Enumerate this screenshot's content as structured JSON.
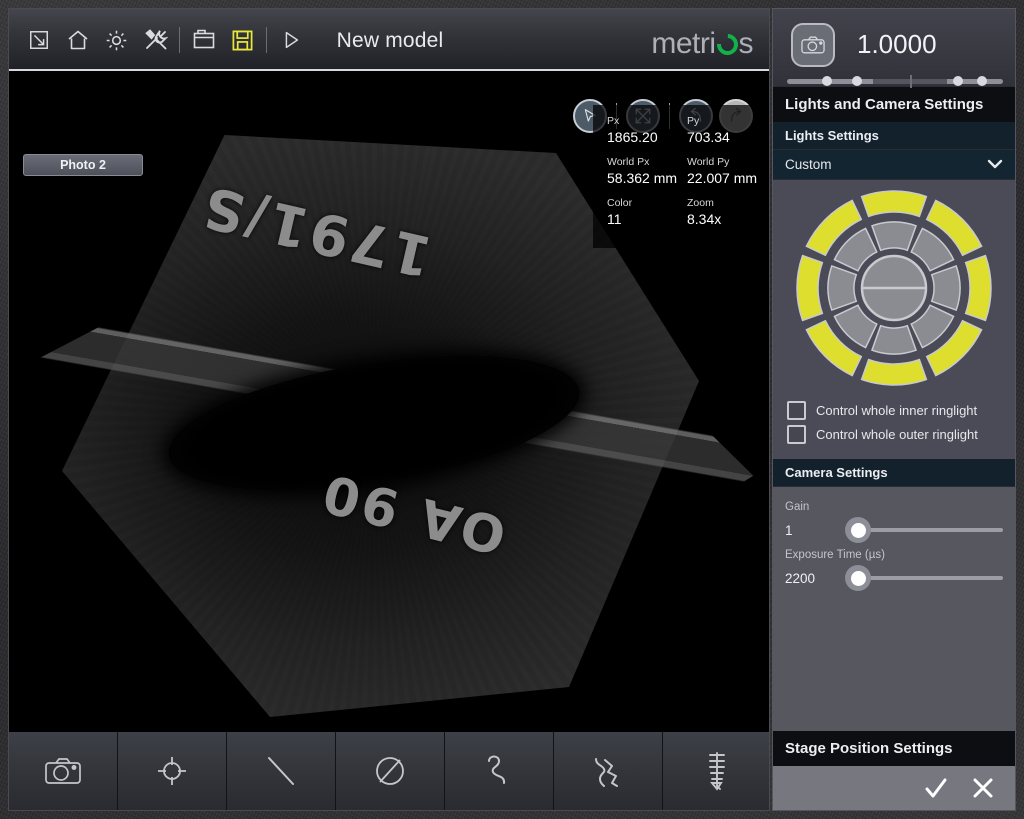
{
  "window": {
    "title": "New model",
    "brand": "metri",
    "brand_tail": "s"
  },
  "toolbar": {
    "items": [
      {
        "name": "resize-icon",
        "label": "Resize"
      },
      {
        "name": "home-icon",
        "label": "Home"
      },
      {
        "name": "gear-icon",
        "label": "Settings"
      },
      {
        "name": "tools-icon",
        "label": "Tools"
      },
      {
        "name": "folder-icon",
        "label": "Open"
      },
      {
        "name": "save-icon",
        "label": "Save"
      },
      {
        "name": "play-icon",
        "label": "Run"
      }
    ]
  },
  "canvas": {
    "photo_tab": "Photo 2",
    "marking_top": "1791/S",
    "marking_bottom": "OA 90",
    "nav_buttons": [
      {
        "name": "pointer-icon",
        "label": "Select"
      },
      {
        "name": "fit-screen-icon",
        "label": "Fit to screen"
      },
      {
        "name": "undo-icon",
        "label": "Undo"
      },
      {
        "name": "redo-icon",
        "label": "Redo"
      }
    ]
  },
  "info": {
    "px_label": "Px",
    "px_value": "1865.20",
    "py_label": "Py",
    "py_value": "703.34",
    "world_px_label": "World Px",
    "world_px_value": "58.362 mm",
    "world_py_label": "World Py",
    "world_py_value": "22.007 mm",
    "color_label": "Color",
    "color_value": "11",
    "zoom_label": "Zoom",
    "zoom_value": "8.34x"
  },
  "measure_tools": [
    {
      "name": "camera-icon",
      "label": "Capture photo"
    },
    {
      "name": "point-icon",
      "label": "Point"
    },
    {
      "name": "line-icon",
      "label": "Line"
    },
    {
      "name": "circle-icon",
      "label": "Circle"
    },
    {
      "name": "curve-icon",
      "label": "Curve"
    },
    {
      "name": "profile-icon",
      "label": "Profile"
    },
    {
      "name": "thread-icon",
      "label": "Thread"
    }
  ],
  "right_panel": {
    "zoom_factor": "1.0000",
    "camera_badge_icon": "camera-icon",
    "section_title": "Lights and Camera Settings",
    "lights": {
      "sub_title": "Lights Settings",
      "preset_selected": "Custom",
      "preset_options": [
        "Custom"
      ],
      "outer_ring_color": "#ddde2e",
      "inner_ring_color": "#8a8c92",
      "checkboxes": [
        {
          "label": "Control whole inner ringlight",
          "checked": false
        },
        {
          "label": "Control whole outer ringlight",
          "checked": false
        }
      ]
    },
    "camera": {
      "sub_title": "Camera Settings",
      "gain_label": "Gain",
      "gain_value": "1",
      "exposure_label": "Exposure Time (µs)",
      "exposure_value": "2200"
    },
    "stage_title": "Stage Position Settings",
    "footer": {
      "confirm_label": "✓",
      "cancel_label": "✕"
    }
  }
}
